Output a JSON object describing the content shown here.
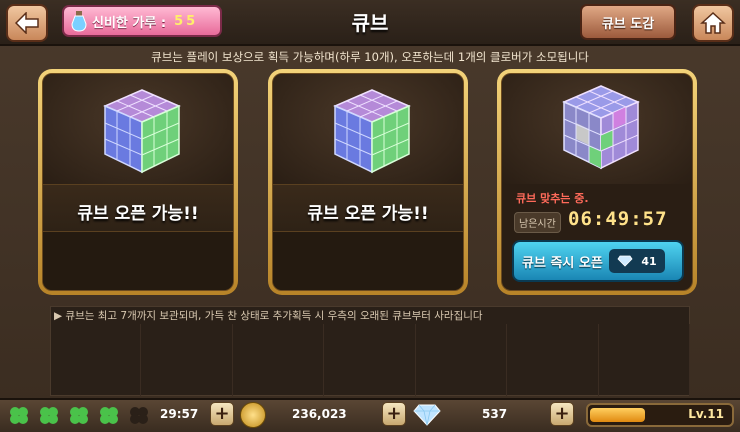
{
  "header": {
    "powder_label": "신비한 가루 :",
    "powder_value": "55",
    "title": "큐브",
    "dex_label": "큐브 도감"
  },
  "notice": "큐브는 플레이 보상으로 획득 가능하며(하루 10개), 오픈하는데 1개의 클로버가 소모됩니다",
  "cards": [
    {
      "label": "큐브 오픈 가능!!"
    },
    {
      "label": "큐브 오픈 가능!!"
    },
    {
      "status": "큐브 맞추는 중.",
      "remain_label": "남은시간",
      "remain_value": "06:49:57",
      "instant_label": "큐브 즉시 오픈",
      "instant_cost": "41"
    }
  ],
  "log": {
    "line": "▶ 큐브는 최고 7개까지 보관되며, 가득 찬 상태로 추가획득 시 우측의 오래된 큐브부터 사라집니다"
  },
  "bottom": {
    "clover_timer": "29:57",
    "gold": "236,023",
    "diamonds": "537",
    "level": "Lv.11",
    "xp_fraction": 0.55
  }
}
